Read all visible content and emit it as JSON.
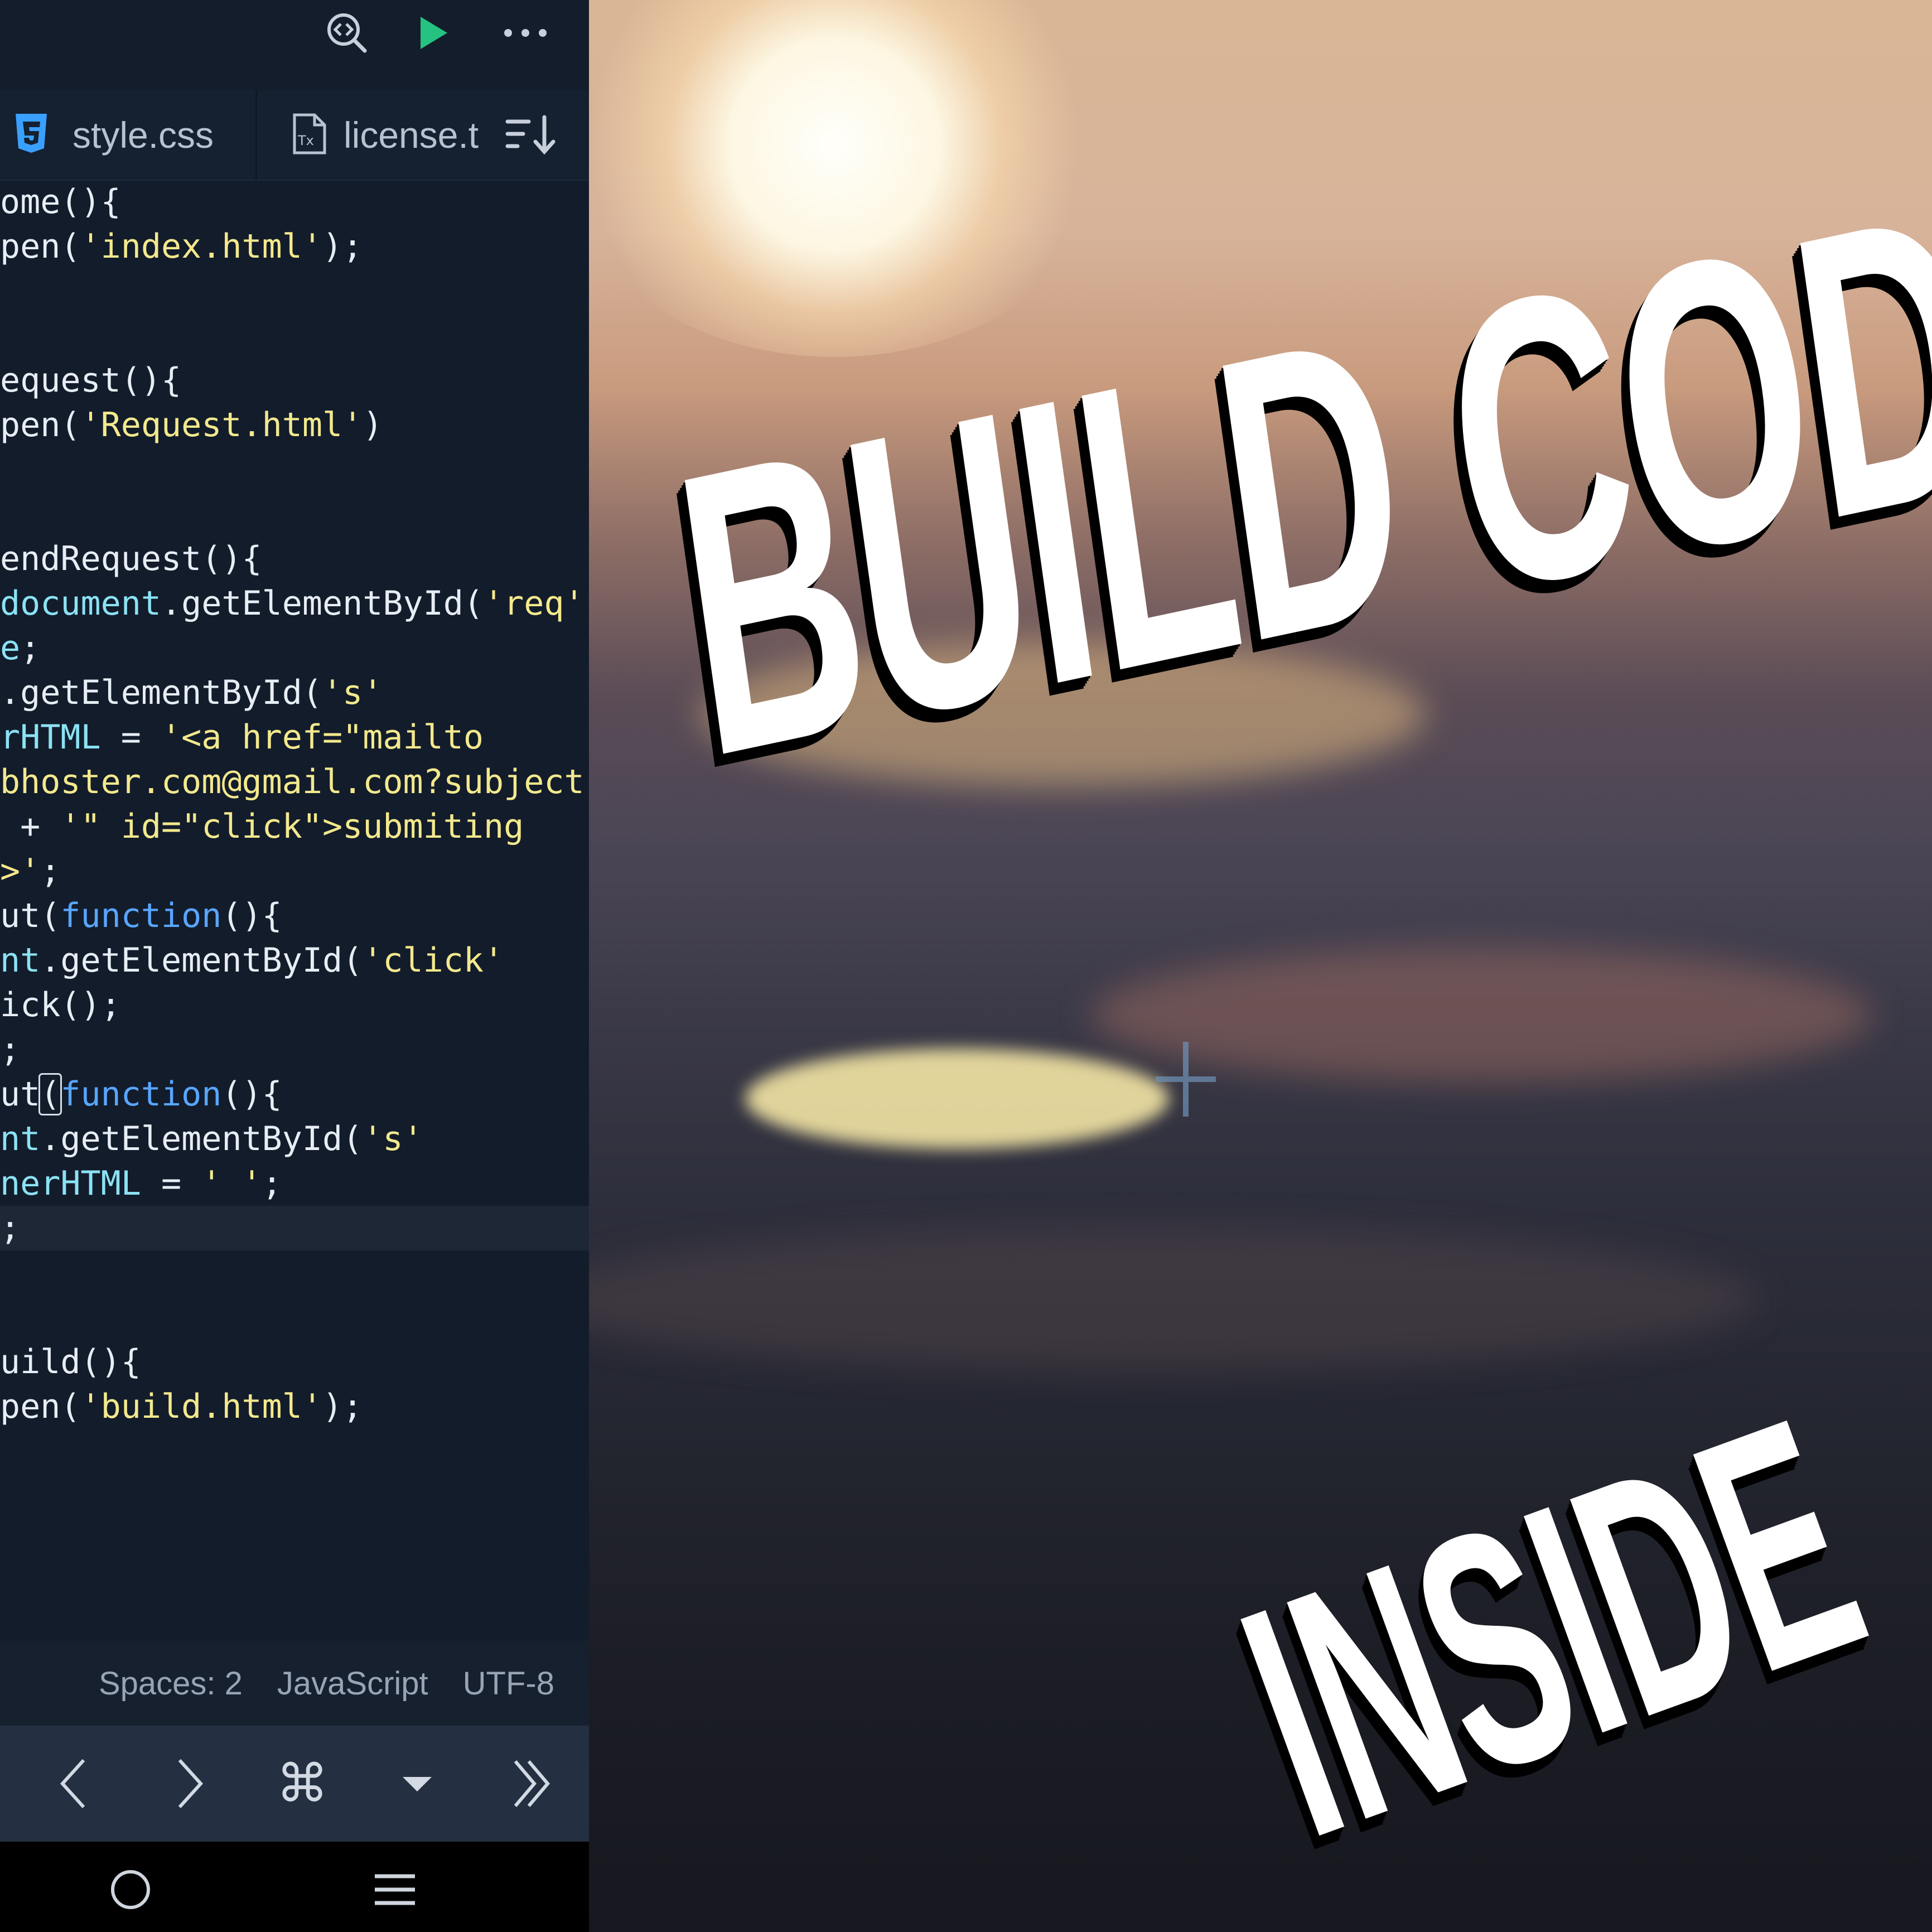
{
  "toolbar": {
    "icons": [
      "preview-search-icon",
      "run-icon",
      "more-icon"
    ],
    "run_color": "#26c281"
  },
  "tabs": [
    {
      "label": "style.css",
      "icon": "css3-icon",
      "icon_color": "#3aa0ff"
    },
    {
      "label": "license.t",
      "icon": "text-file-icon"
    }
  ],
  "tabs_sort_icon": "sort-icon",
  "code": [
    [
      [
        "t",
        "ome(){"
      ]
    ],
    [
      [
        "t",
        "pen("
      ],
      [
        "s",
        "'index.html'"
      ],
      [
        "t",
        ");"
      ]
    ],
    [],
    [],
    [
      [
        "t",
        "equest(){"
      ]
    ],
    [
      [
        "t",
        "pen("
      ],
      [
        "s",
        "'Request.html'"
      ],
      [
        "t",
        ")"
      ]
    ],
    [],
    [],
    [
      [
        "t",
        "endRequest(){"
      ]
    ],
    [
      [
        "o",
        "document"
      ],
      [
        "t",
        ".getElementById("
      ],
      [
        "s",
        "'req'"
      ]
    ],
    [
      [
        "o",
        "e"
      ],
      [
        "t",
        ";"
      ]
    ],
    [
      [
        "t",
        ".getElementById("
      ],
      [
        "s",
        "'s'"
      ]
    ],
    [
      [
        "o",
        "rHTML"
      ],
      [
        "t",
        " = "
      ],
      [
        "s",
        "'<a href=\"mailto"
      ]
    ],
    [
      [
        "s",
        "bhoster.com@gmail.com?subject"
      ]
    ],
    [
      [
        "t",
        " + "
      ],
      [
        "s",
        "'\" id=\"click\">submiting"
      ]
    ],
    [
      [
        "s",
        ">'"
      ],
      [
        "t",
        ";"
      ]
    ],
    [
      [
        "t",
        "ut("
      ],
      [
        "k",
        "function"
      ],
      [
        "t",
        "(){"
      ]
    ],
    [
      [
        "o",
        "nt"
      ],
      [
        "t",
        ".getElementById("
      ],
      [
        "s",
        "'click'"
      ]
    ],
    [
      [
        "t",
        "ick();"
      ]
    ],
    [
      [
        "t",
        ";"
      ]
    ],
    [
      [
        "t",
        "ut"
      ],
      [
        "b",
        "("
      ],
      [
        "k",
        "function"
      ],
      [
        "t",
        "(){"
      ]
    ],
    [
      [
        "o",
        "nt"
      ],
      [
        "t",
        ".getElementById("
      ],
      [
        "s",
        "'s'"
      ]
    ],
    [
      [
        "o",
        "nerHTML"
      ],
      [
        "t",
        " = "
      ],
      [
        "s",
        "' '"
      ],
      [
        "t",
        ";"
      ]
    ],
    [
      [
        "t",
        ";"
      ]
    ],
    [],
    [],
    [
      [
        "t",
        "uild(){"
      ]
    ],
    [
      [
        "t",
        "pen("
      ],
      [
        "s",
        "'build.html'"
      ],
      [
        "t",
        ");"
      ]
    ]
  ],
  "code_line_tops": [
    0,
    80,
    160,
    240,
    320,
    400,
    480,
    560,
    640,
    720,
    800,
    880,
    960,
    1040,
    1120,
    1200,
    1280,
    1360,
    1440,
    1520,
    1600,
    1680,
    1760,
    1840,
    1920,
    2000,
    2080,
    2160
  ],
  "active_line": 23,
  "status": {
    "spaces": "Spaces: 2",
    "language": "JavaScript",
    "encoding": "UTF-8"
  },
  "keybar": {
    "icons": [
      "chevron-left-icon",
      "chevron-right-icon",
      "command-icon",
      "caret-down-icon",
      "double-chevron-right-icon"
    ]
  },
  "navbar": {
    "icons": [
      "home-circle-icon",
      "menu-icon"
    ]
  },
  "headline": {
    "line1": "BUILD CODER",
    "line2": "INSIDE"
  }
}
